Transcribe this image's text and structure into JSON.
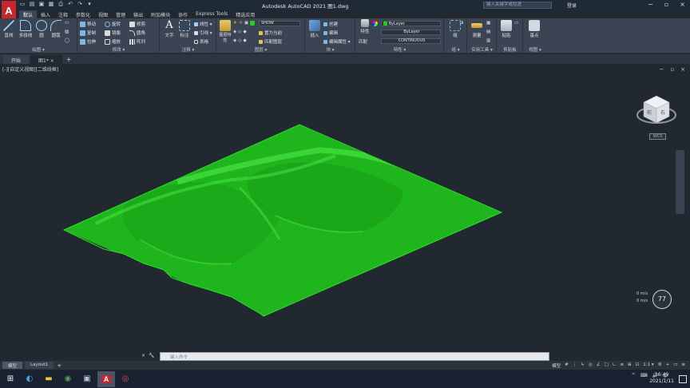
{
  "app": {
    "logo": "A",
    "title": "Autodesk AutoCAD 2021   图1.dwg",
    "search_placeholder": "键入关键字或短语",
    "login": "登录",
    "qat_icons": [
      "new-icon",
      "open-icon",
      "save-icon",
      "saveas-icon",
      "plot-icon",
      "undo-icon",
      "redo-icon",
      "share-icon"
    ]
  },
  "ribbon_tabs": [
    "默认",
    "插入",
    "注释",
    "参数化",
    "视图",
    "管理",
    "输出",
    "附加模块",
    "协作",
    "Express Tools",
    "精选应用"
  ],
  "ribbon": {
    "draw": {
      "title": "绘图 ▾",
      "big": [
        "直线",
        "多段线",
        "圆",
        "圆弧"
      ]
    },
    "modify": {
      "title": "修改 ▾",
      "rows": [
        [
          "移动",
          "旋转",
          "修剪"
        ],
        [
          "复制",
          "镜像",
          "圆角"
        ],
        [
          "拉伸",
          "缩放",
          "阵列"
        ]
      ]
    },
    "annotation": {
      "title": "注释 ▾",
      "big": [
        "文字",
        "标注"
      ],
      "rows": [
        "线性 ▾",
        "引线 ▾",
        "表格"
      ]
    },
    "layers": {
      "title": "图层 ▾",
      "big": "图层特性",
      "current": "SHOW",
      "rows": [
        "置为当前",
        "匹配图层"
      ]
    },
    "block": {
      "title": "块 ▾",
      "big": "插入",
      "rows": [
        "创建",
        "编辑",
        "编辑属性 ▾"
      ]
    },
    "properties": {
      "title": "特性 ▾",
      "big": [
        "特性",
        "匹配"
      ],
      "bylayer1": "ByLayer",
      "bylayer2": "ByLayer",
      "linetype": "CONTINUOUS"
    },
    "groups": {
      "title": "组 ▾",
      "big": "组"
    },
    "utilities": {
      "title": "实用工具 ▾",
      "big": "测量"
    },
    "clipboard": {
      "title": "剪贴板",
      "big": "粘贴"
    },
    "view": {
      "title": "视图 ▾",
      "big": "基点"
    }
  },
  "doc_tabs": [
    "开始",
    "图1*"
  ],
  "doc_add": "+",
  "drawing": {
    "view_label": "[-][自定义视图][二维线框]",
    "vp_controls": [
      "−",
      "▫",
      "×"
    ],
    "wcs": "WCS",
    "navwheel": "77",
    "navstat": [
      "0 m/s",
      "0 m/s"
    ],
    "wire_color": "#22d11e"
  },
  "command": {
    "placeholder": "键入命令",
    "icons": [
      "×",
      "🔧"
    ]
  },
  "layout_tabs": [
    "模型",
    "Layout1"
  ],
  "layout_add": "+",
  "status": [
    "模型",
    "#",
    "⋮",
    "↳",
    "◎",
    "∠",
    "□",
    "∟",
    "≡",
    "⊞",
    "⊡",
    "1:1 ▾",
    "⚙",
    "+",
    "▭",
    "≡"
  ],
  "taskbar": {
    "clock_time": "16:49",
    "clock_date": "2021/1/11",
    "tray": [
      "^",
      "⌨",
      "🔊",
      "中"
    ]
  }
}
